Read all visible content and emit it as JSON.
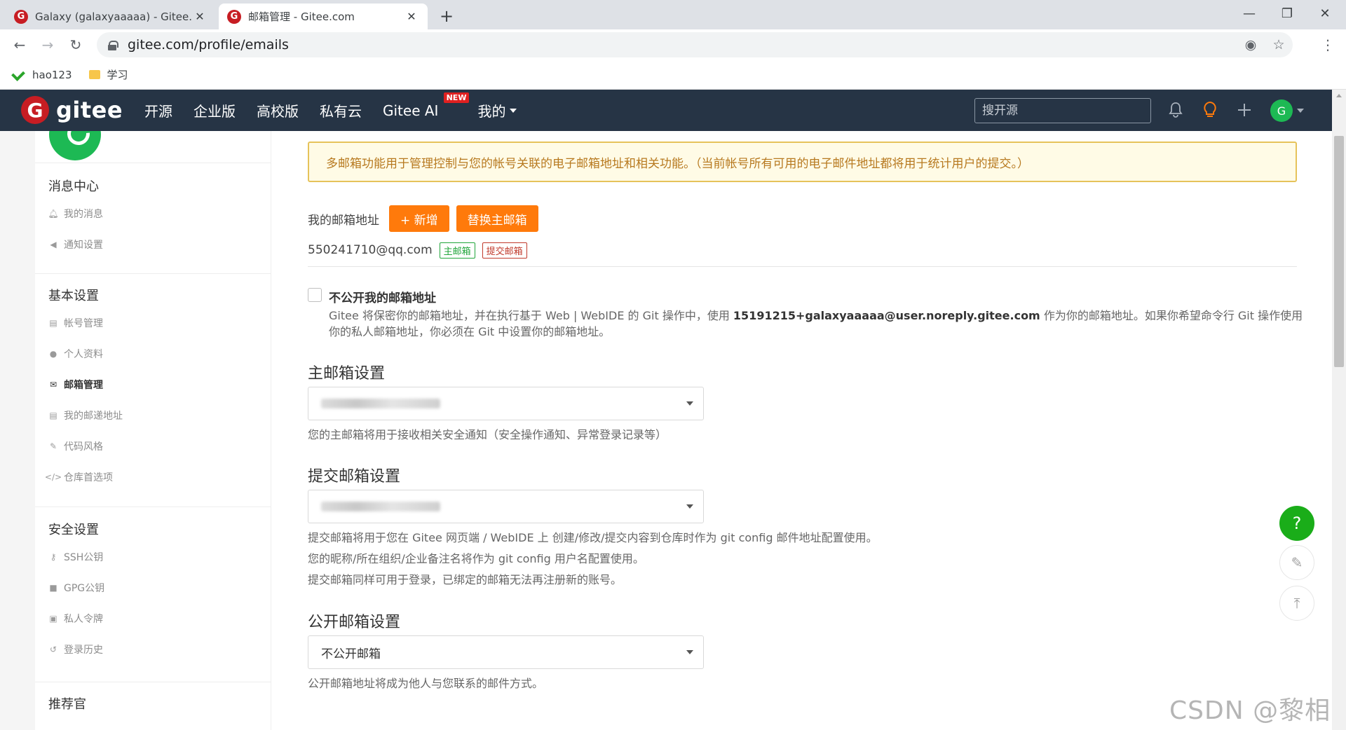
{
  "browser": {
    "tabs": [
      {
        "title": "Galaxy (galaxyaaaaa) - Gitee.com",
        "favicon": "G"
      },
      {
        "title": "邮箱管理 - Gitee.com",
        "favicon": "G"
      }
    ],
    "url": "gitee.com/profile/emails",
    "bookmarks": [
      {
        "label": "hao123",
        "icon": "hao123-icon"
      },
      {
        "label": "学习",
        "icon": "folder-icon"
      }
    ]
  },
  "gitee_nav": {
    "logo_text": "gitee",
    "logo_mark": "G",
    "links": [
      "开源",
      "企业版",
      "高校版",
      "私有云",
      "Gitee AI",
      "我的"
    ],
    "new_badge": "NEW",
    "search_placeholder": "搜开源",
    "avatar_letter": "G"
  },
  "sidebar": {
    "sections": [
      {
        "title": "消息中心",
        "items": [
          {
            "label": "我的消息",
            "icon": "bell-icon"
          },
          {
            "label": "通知设置",
            "icon": "speaker-icon"
          }
        ]
      },
      {
        "title": "基本设置",
        "items": [
          {
            "label": "帐号管理",
            "icon": "id-card-icon"
          },
          {
            "label": "个人资料",
            "icon": "user-icon"
          },
          {
            "label": "邮箱管理",
            "icon": "envelope-icon",
            "active": true
          },
          {
            "label": "我的邮递地址",
            "icon": "address-card-icon"
          },
          {
            "label": "代码风格",
            "icon": "brush-icon"
          },
          {
            "label": "仓库首选项",
            "icon": "code-icon"
          }
        ]
      },
      {
        "title": "安全设置",
        "items": [
          {
            "label": "SSH公钥",
            "icon": "key-icon"
          },
          {
            "label": "GPG公钥",
            "icon": "lock-icon"
          },
          {
            "label": "私人令牌",
            "icon": "token-icon"
          },
          {
            "label": "登录历史",
            "icon": "history-icon"
          }
        ]
      },
      {
        "title": "推荐官",
        "items": []
      }
    ]
  },
  "content": {
    "notice": "多邮箱功能用于管理控制与您的帐号关联的电子邮箱地址和相关功能。（当前帐号所有可用的电子邮件地址都将用于统计用户的提交。）",
    "my_emails_label": "我的邮箱地址",
    "add_button": "+ 新增",
    "replace_button": "替换主邮箱",
    "email": "550241710@qq.com",
    "tag_primary": "主邮箱",
    "tag_commit": "提交邮箱",
    "privacy": {
      "title": "不公开我的邮箱地址",
      "desc_before": "Gitee 将保密你的邮箱地址，并在执行基于 Web | WebIDE 的 Git 操作中，使用 ",
      "noreply_email": "15191215+galaxyaaaaa@user.noreply.gitee.com",
      "desc_after": " 作为你的邮箱地址。如果你希望命令行 Git 操作使用你的私人邮箱地址，你必须在 Git 中设置你的邮箱地址。"
    },
    "primary_section": {
      "title": "主邮箱设置",
      "help": "您的主邮箱将用于接收相关安全通知（安全操作通知、异常登录记录等）"
    },
    "commit_section": {
      "title": "提交邮箱设置",
      "help": [
        "提交邮箱将用于您在 Gitee 网页端 / WebIDE 上 创建/修改/提交内容到仓库时作为 git config 邮件地址配置使用。",
        "您的昵称/所在组织/企业备注名将作为 git config 用户名配置使用。",
        "提交邮箱同样可用于登录，已绑定的邮箱无法再注册新的账号。"
      ]
    },
    "public_section": {
      "title": "公开邮箱设置",
      "selected": "不公开邮箱",
      "help": "公开邮箱地址将成为他人与您联系的邮件方式。"
    }
  },
  "floating": {
    "help": "?"
  },
  "watermark": "CSDN @黎相思",
  "colors": {
    "accent_orange": "#ff7a0b",
    "nav_bg": "#263445",
    "brand_red": "#c71d23",
    "green": "#1aad19"
  }
}
